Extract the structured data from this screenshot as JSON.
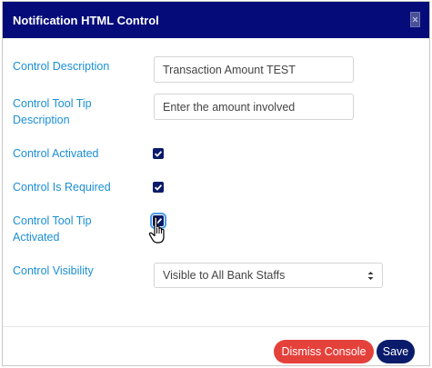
{
  "dialog": {
    "title": "Notification HTML Control",
    "close_icon": "close-icon"
  },
  "form": {
    "description_label": "Control Description",
    "description_value": "Transaction Amount TEST",
    "tooltip_desc_label_line1": "Control Tool Tip",
    "tooltip_desc_label_line2": "Description",
    "tooltip_desc_value": "Enter the amount involved",
    "activated_label": "Control Activated",
    "activated_checked": true,
    "required_label": "Control Is Required",
    "required_checked": true,
    "tooltip_activated_label_line1": "Control Tool Tip",
    "tooltip_activated_label_line2": "Activated",
    "tooltip_activated_checked": true,
    "visibility_label": "Control Visibility",
    "visibility_value": "Visible to All Bank Staffs"
  },
  "footer": {
    "dismiss_label": "Dismiss Console",
    "save_label": "Save"
  },
  "colors": {
    "header_bg": "#050c7a",
    "label_blue": "#1a8fd6",
    "dismiss_red": "#e5413b",
    "save_navy": "#0a1b6b"
  }
}
